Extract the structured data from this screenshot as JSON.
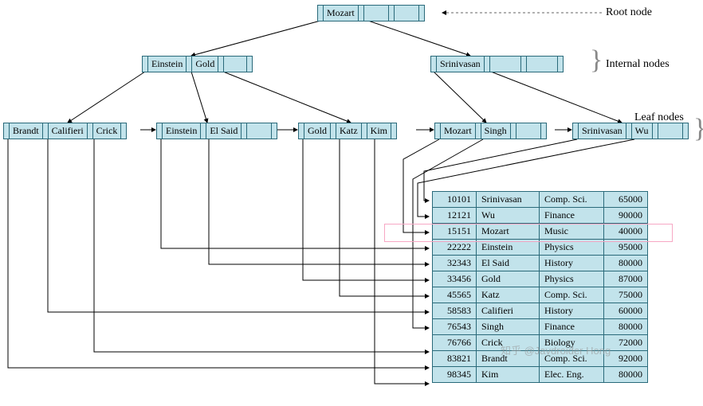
{
  "labels": {
    "root": "Root node",
    "internal": "Internal nodes",
    "leaf": "Leaf nodes"
  },
  "tree": {
    "root": {
      "keys": [
        "Mozart",
        "",
        ""
      ]
    },
    "internal": [
      {
        "keys": [
          "Einstein",
          "Gold",
          ""
        ]
      },
      {
        "keys": [
          "Srinivasan",
          "",
          ""
        ]
      }
    ],
    "leaves": [
      {
        "keys": [
          "Brandt",
          "Califieri",
          "Crick"
        ]
      },
      {
        "keys": [
          "Einstein",
          "El Said",
          ""
        ]
      },
      {
        "keys": [
          "Gold",
          "Katz",
          "Kim"
        ]
      },
      {
        "keys": [
          "Mozart",
          "Singh",
          ""
        ]
      },
      {
        "keys": [
          "Srinivasan",
          "Wu",
          ""
        ]
      }
    ]
  },
  "table": {
    "rows": [
      {
        "id": "10101",
        "name": "Srinivasan",
        "dept": "Comp. Sci.",
        "salary": "65000"
      },
      {
        "id": "12121",
        "name": "Wu",
        "dept": "Finance",
        "salary": "90000"
      },
      {
        "id": "15151",
        "name": "Mozart",
        "dept": "Music",
        "salary": "40000"
      },
      {
        "id": "22222",
        "name": "Einstein",
        "dept": "Physics",
        "salary": "95000"
      },
      {
        "id": "32343",
        "name": "El Said",
        "dept": "History",
        "salary": "80000"
      },
      {
        "id": "33456",
        "name": "Gold",
        "dept": "Physics",
        "salary": "87000"
      },
      {
        "id": "45565",
        "name": "Katz",
        "dept": "Comp. Sci.",
        "salary": "75000"
      },
      {
        "id": "58583",
        "name": "Califieri",
        "dept": "History",
        "salary": "60000"
      },
      {
        "id": "76543",
        "name": "Singh",
        "dept": "Finance",
        "salary": "80000"
      },
      {
        "id": "76766",
        "name": "Crick",
        "dept": "Biology",
        "salary": "72000"
      },
      {
        "id": "83821",
        "name": "Brandt",
        "dept": "Comp. Sci.",
        "salary": "92000"
      },
      {
        "id": "98345",
        "name": "Kim",
        "dept": "Elec. Eng.",
        "salary": "80000"
      }
    ]
  },
  "watermark": "知乎 @Javdroider Hong"
}
